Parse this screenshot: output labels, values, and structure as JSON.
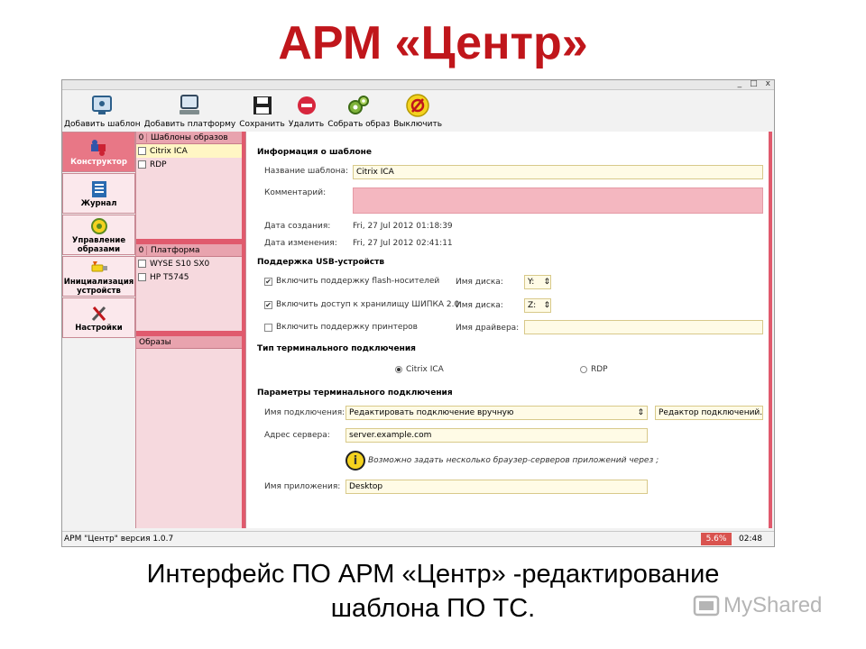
{
  "slide": {
    "title": "АРМ «Центр»",
    "caption_line1": "Интерфейс ПО АРМ «Центр» -редактирование",
    "caption_line2": "шаблона ПО ТС.",
    "logo_text": "MyShared"
  },
  "window_controls": [
    "_",
    "□",
    "x"
  ],
  "toolbar": [
    {
      "label": "Добавить шаблон",
      "icon": "add-template-icon"
    },
    {
      "label": "Добавить платформу",
      "icon": "add-platform-icon"
    },
    {
      "label": "Сохранить",
      "icon": "save-icon"
    },
    {
      "label": "Удалить",
      "icon": "delete-icon"
    },
    {
      "label": "Собрать образ",
      "icon": "build-image-icon"
    },
    {
      "label": "Выключить",
      "icon": "power-off-icon"
    }
  ],
  "nav": [
    {
      "label": "Конструктор",
      "icon": "puzzle-icon",
      "active": true
    },
    {
      "label": "Журнал",
      "icon": "journal-icon"
    },
    {
      "label": "Управление образами",
      "icon": "images-icon"
    },
    {
      "label": "Инициализация устройств",
      "icon": "usb-icon"
    },
    {
      "label": "Настройки",
      "icon": "tools-icon"
    }
  ],
  "panels": {
    "templates": {
      "count": "0",
      "title": "Шаблоны образов",
      "items": [
        "Citrix ICA",
        "RDP"
      ]
    },
    "platforms": {
      "count": "0",
      "title": "Платформа",
      "items": [
        "WYSE S10 SX0",
        "HP T5745"
      ]
    },
    "images": {
      "title": "Образы"
    }
  },
  "form": {
    "info_section": "Информация о шаблоне",
    "name_label": "Название шаблона:",
    "name_value": "Citrix ICA",
    "comment_label": "Комментарий:",
    "created_label": "Дата создания:",
    "created_value": "Fri, 27 Jul 2012 01:18:39",
    "modified_label": "Дата изменения:",
    "modified_value": "Fri, 27 Jul 2012 02:41:11",
    "usb_section": "Поддержка USB-устройств",
    "usb_flash": "Включить поддержку flash-носителей",
    "usb_flash_checked": true,
    "usb_shipka": "Включить доступ к хранилищу ШИПКА 2.0",
    "usb_shipka_checked": true,
    "printers": "Включить поддержку принтеров",
    "printers_checked": false,
    "disk_label": "Имя диска:",
    "disk1_value": "Y:",
    "disk2_value": "Z:",
    "driver_label": "Имя драйвера:",
    "conn_type_section": "Тип терминального подключения",
    "conn_type_citrix": "Citrix ICA",
    "conn_type_rdp": "RDP",
    "conn_type_selected": "Citrix ICA",
    "conn_params_section": "Параметры терминального подключения",
    "conn_name_label": "Имя подключения:",
    "conn_name_value": "Редактировать подключение вручную",
    "conn_editor_button": "Редактор подключений...",
    "server_label": "Адрес сервера:",
    "server_value": "server.example.com",
    "info_text": "Возможно задать несколько браузер-серверов приложений через ;",
    "app_label": "Имя приложения:",
    "app_value": "Desktop"
  },
  "status": {
    "version": "АРМ \"Центр\" версия 1.0.7",
    "percent": "5.6%",
    "time": "02:48"
  }
}
